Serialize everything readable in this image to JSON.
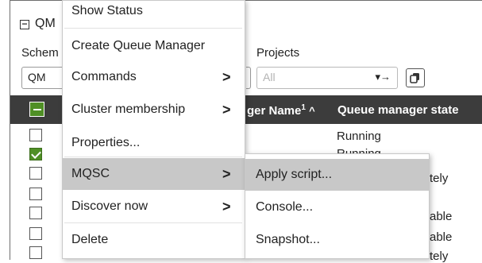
{
  "panel": {
    "title": "QM"
  },
  "filters": {
    "schema_label": "Schem",
    "schema_value": "QM",
    "projects_label": "Projects",
    "projects_placeholder": "All",
    "projects_caret": "▾→"
  },
  "table": {
    "headers": {
      "name": "ger Name",
      "name_sort": "1",
      "name_sort_arrow": "^",
      "state": "Queue manager state"
    },
    "rows": [
      {
        "checked": false,
        "state": "Running"
      },
      {
        "checked": true,
        "state": "Running"
      },
      {
        "checked": false,
        "state": "tely"
      },
      {
        "checked": false,
        "state": ""
      },
      {
        "checked": false,
        "state": "able"
      },
      {
        "checked": false,
        "state": "able"
      },
      {
        "checked": false,
        "state": "tely"
      }
    ]
  },
  "context_menu": {
    "items": [
      {
        "label": "Show Status",
        "submenu": false
      },
      {
        "label": "Create Queue Manager",
        "submenu": false
      },
      {
        "label": "Commands",
        "submenu": true
      },
      {
        "label": "Cluster membership",
        "submenu": true
      },
      {
        "label": "Properties...",
        "submenu": false
      },
      {
        "label": "MQSC",
        "submenu": true
      },
      {
        "label": "Discover now",
        "submenu": true
      },
      {
        "label": "Delete",
        "submenu": false
      }
    ],
    "chevron": ">"
  },
  "mqsc_submenu": {
    "items": [
      {
        "label": "Apply script..."
      },
      {
        "label": "Console..."
      },
      {
        "label": "Snapshot..."
      }
    ]
  },
  "colors": {
    "header_bg": "#3c3c3c",
    "check_green": "#4f8f25",
    "highlight": "#c8c8c8"
  }
}
